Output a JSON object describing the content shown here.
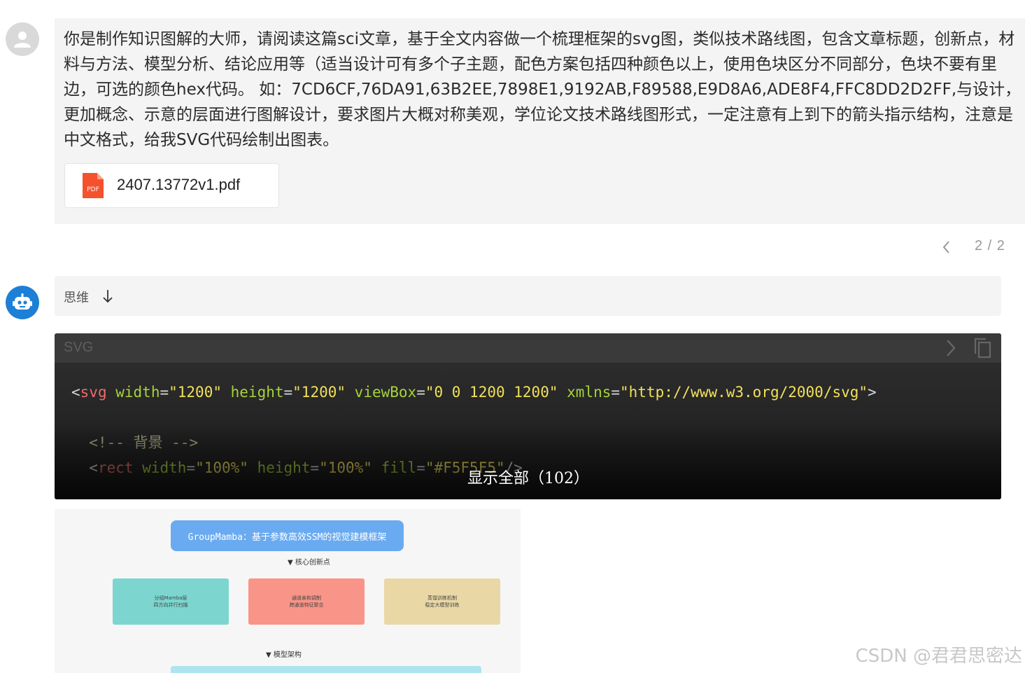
{
  "user_message": {
    "text": "你是制作知识图解的大师，请阅读这篇sci文章，基于全文内容做一个梳理框架的svg图，类似技术路线图，包含文章标题，创新点，材料与方法、模型分析、结论应用等（适当设计可有多个子主题，配色方案包括四种颜色以上，使用色块区分不同部分，色块不要有里边，可选的颜色hex代码。 如：7CD6CF,76DA91,63B2EE,7898E1,9192AB,F89588,E9D8A6,ADE8F4,FFC8DD2D2FF,与设计，更加概念、示意的层面进行图解设计，要求图片大概对称美观，学位论文技术路线图形式，一定注意有上到下的箭头指示结构，注意是中文格式，给我SVG代码绘制出图表。",
    "attachment": {
      "filename": "2407.13772v1.pdf",
      "icon": "pdf-file-icon",
      "badge": "PDF"
    }
  },
  "pager": {
    "count": "2 / 2"
  },
  "bot_reply": {
    "thinking_label": "思维",
    "code": {
      "language": "SVG",
      "line1": {
        "open": "<",
        "tag": "svg",
        "a1": "width",
        "v1": "\"1200\"",
        "a2": "height",
        "v2": "\"1200\"",
        "a3": "viewBox",
        "v3": "\"0 0 1200 1200\"",
        "a4": "xmlns",
        "v4": "\"http://www.w3.org/2000/svg\"",
        "close": ">"
      },
      "line2": {
        "comment": "<!-- 背景 -->"
      },
      "line3": {
        "open": "<",
        "tag": "rect",
        "a1": "width",
        "v1": "\"100%\"",
        "a2": "height",
        "v2": "\"100%\"",
        "a3": "fill",
        "v3": "\"#F5F5F5\"",
        "close": "/>"
      },
      "show_all": "显示全部（102）"
    },
    "preview": {
      "title": "GroupMamba：基于参数高效SSM的视觉建模框架",
      "section1": "▼ 核心创新点",
      "cards": [
        {
          "line1": "分组Mamba层",
          "line2": "四方向并行扫描",
          "color": "#7cd6cf"
        },
        {
          "line1": "通道亲和调制",
          "line2": "跨通道特征聚合",
          "color": "#f89588"
        },
        {
          "line1": "蒸馏训练机制",
          "line2": "稳定大模型训练",
          "color": "#e9d8a6"
        }
      ],
      "section2": "▼ 模型架构"
    }
  },
  "watermark": "CSDN @君君思密达"
}
